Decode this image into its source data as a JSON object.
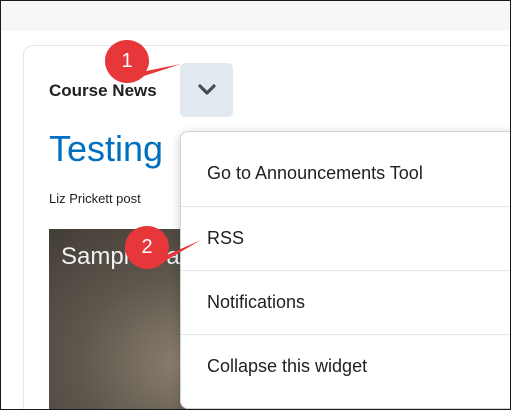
{
  "widget": {
    "title": "Course News",
    "menu_toggle_icon": "chevron-down-icon"
  },
  "news": {
    "headline": "Testing",
    "byline": "Liz Prickett post",
    "media_caption": "Sample Ca"
  },
  "menu": {
    "items": [
      {
        "label": "Go to Announcements Tool"
      },
      {
        "label": "RSS"
      },
      {
        "label": "Notifications"
      },
      {
        "label": "Collapse this widget"
      }
    ]
  },
  "callouts": [
    {
      "number": "1"
    },
    {
      "number": "2"
    }
  ],
  "colors": {
    "link": "#006fbf",
    "callout": "#e8373a",
    "toggle_bg": "#e3e9f1"
  }
}
